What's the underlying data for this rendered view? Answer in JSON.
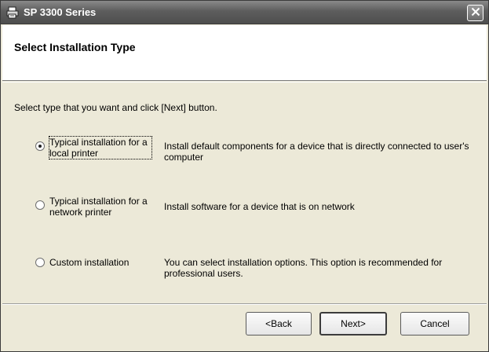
{
  "window": {
    "title": "SP 3300 Series",
    "icon": "printer-icon",
    "close_icon": "close-icon"
  },
  "header": {
    "title": "Select Installation Type"
  },
  "content": {
    "instruction": "Select type that you want and click [Next] button.",
    "options": [
      {
        "label": "Typical installation for a local printer",
        "description": "Install default components for a device that is directly connected to user's computer",
        "selected": true
      },
      {
        "label": "Typical installation for a network printer",
        "description": "Install software for a device that is on network",
        "selected": false
      },
      {
        "label": "Custom installation",
        "description": "You can select installation options. This option is recommended for professional users.",
        "selected": false
      }
    ]
  },
  "buttons": {
    "back": "<Back",
    "next": "Next>",
    "cancel": "Cancel"
  }
}
